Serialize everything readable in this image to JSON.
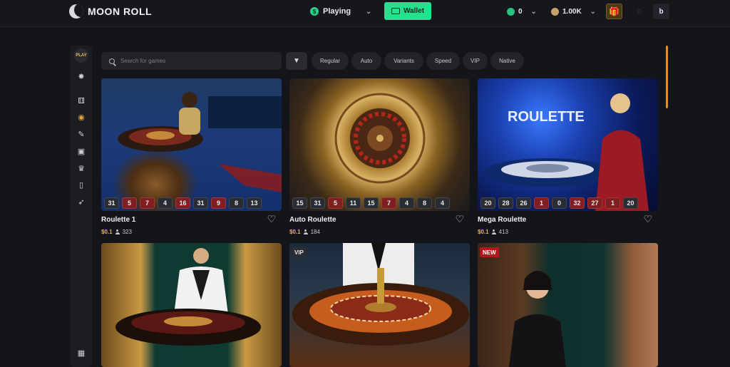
{
  "header": {
    "brand": "MOON ROLL",
    "playing_label": "Playing",
    "wallet_label": "Wallet",
    "gem_balance": "0",
    "coin_balance": "1.00K",
    "user_initial": "b"
  },
  "sidebar": {
    "play_badge": "PLAY",
    "icons": [
      "play-icon",
      "spaceship-icon",
      "dice-icon",
      "chip-icon",
      "wand-icon",
      "cards-icon",
      "trophy-icon",
      "card-icon",
      "rocket-icon",
      "grid-icon"
    ]
  },
  "search": {
    "placeholder": "Search for games"
  },
  "filters": [
    "Regular",
    "Auto",
    "Variants",
    "Speed",
    "VIP",
    "Native"
  ],
  "games": [
    {
      "title": "Roulette 1",
      "price": "$0.1",
      "players": "323",
      "badge": "",
      "results": [
        [
          "31",
          ""
        ],
        [
          "5",
          "red"
        ],
        [
          "7",
          "red"
        ],
        [
          "4",
          ""
        ],
        [
          "16",
          "red"
        ],
        [
          "31",
          ""
        ],
        [
          "9",
          "red"
        ],
        [
          "8",
          ""
        ],
        [
          "13",
          ""
        ]
      ]
    },
    {
      "title": "Auto Roulette",
      "price": "$0.1",
      "players": "184",
      "badge": "",
      "results": [
        [
          "15",
          ""
        ],
        [
          "31",
          ""
        ],
        [
          "5",
          "red"
        ],
        [
          "11",
          ""
        ],
        [
          "15",
          ""
        ],
        [
          "7",
          "red"
        ],
        [
          "4",
          ""
        ],
        [
          "8",
          ""
        ],
        [
          "4",
          ""
        ]
      ]
    },
    {
      "title": "Mega Roulette",
      "price": "$0.1",
      "players": "413",
      "badge": "",
      "results": [
        [
          "20",
          ""
        ],
        [
          "28",
          ""
        ],
        [
          "26",
          ""
        ],
        [
          "1",
          "red"
        ],
        [
          "0",
          ""
        ],
        [
          "32",
          "red"
        ],
        [
          "27",
          "red"
        ],
        [
          "1",
          "red"
        ],
        [
          "20",
          ""
        ]
      ]
    },
    {
      "title": "",
      "price": "",
      "players": "",
      "badge": "",
      "results": []
    },
    {
      "title": "",
      "price": "",
      "players": "",
      "badge": "VIP",
      "results": []
    },
    {
      "title": "",
      "price": "",
      "players": "",
      "badge": "NEW",
      "results": []
    }
  ],
  "colors": {
    "accent": "#22e28e",
    "scroll": "#e88c22",
    "price": "#e4b54b"
  }
}
